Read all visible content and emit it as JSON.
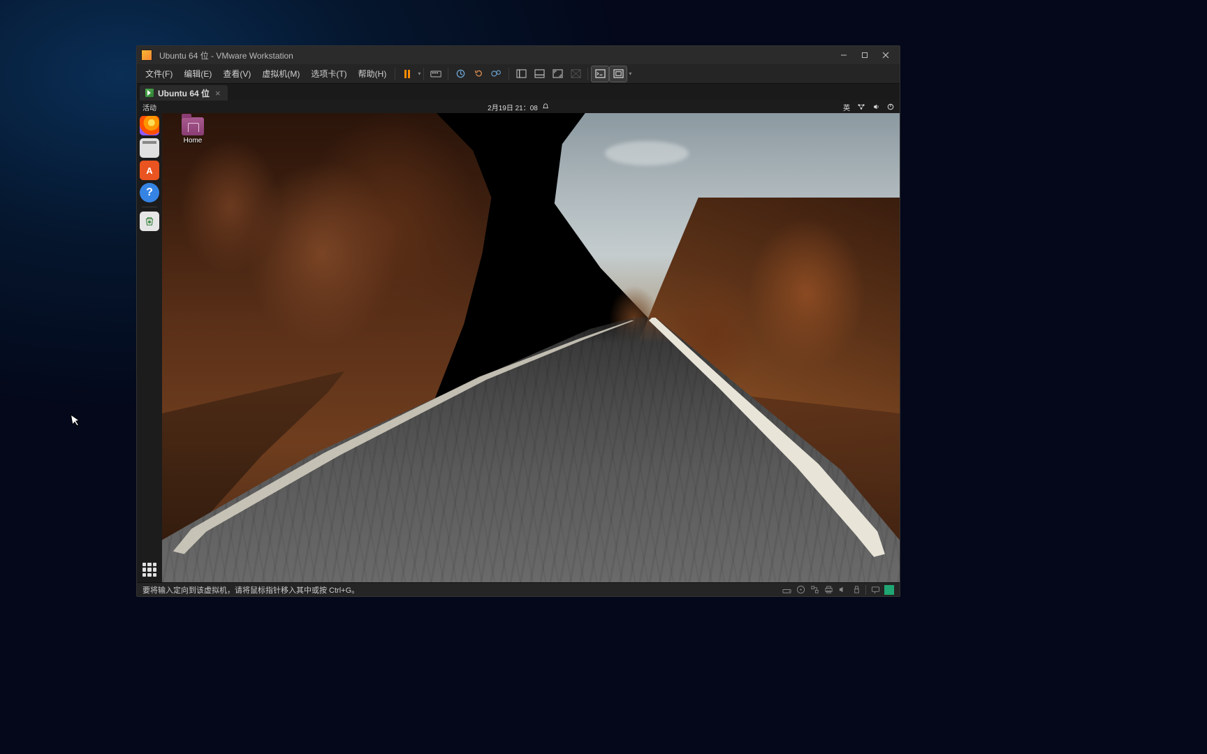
{
  "window": {
    "title": "Ubuntu 64 位 - VMware Workstation"
  },
  "menus": {
    "file": "文件(F)",
    "edit": "编辑(E)",
    "view": "查看(V)",
    "vm": "虚拟机(M)",
    "tabs": "选项卡(T)",
    "help": "帮助(H)"
  },
  "tab": {
    "label": "Ubuntu 64 位"
  },
  "ubuntu": {
    "activities": "活动",
    "datetime": "2月19日 21：08",
    "input_method": "英",
    "desktop_home_label": "Home"
  },
  "statusbar": {
    "message": "要将输入定向到该虚拟机，请将鼠标指针移入其中或按 Ctrl+G。"
  },
  "icons": {
    "pause": "pause",
    "snapshot": "snapshot",
    "revert": "revert",
    "manage": "manage-snapshots",
    "split_left": "show-library",
    "split_mid": "show-thumbnail",
    "fullscreen": "fullscreen",
    "unity": "unity",
    "console": "console",
    "stretch": "stretch"
  }
}
